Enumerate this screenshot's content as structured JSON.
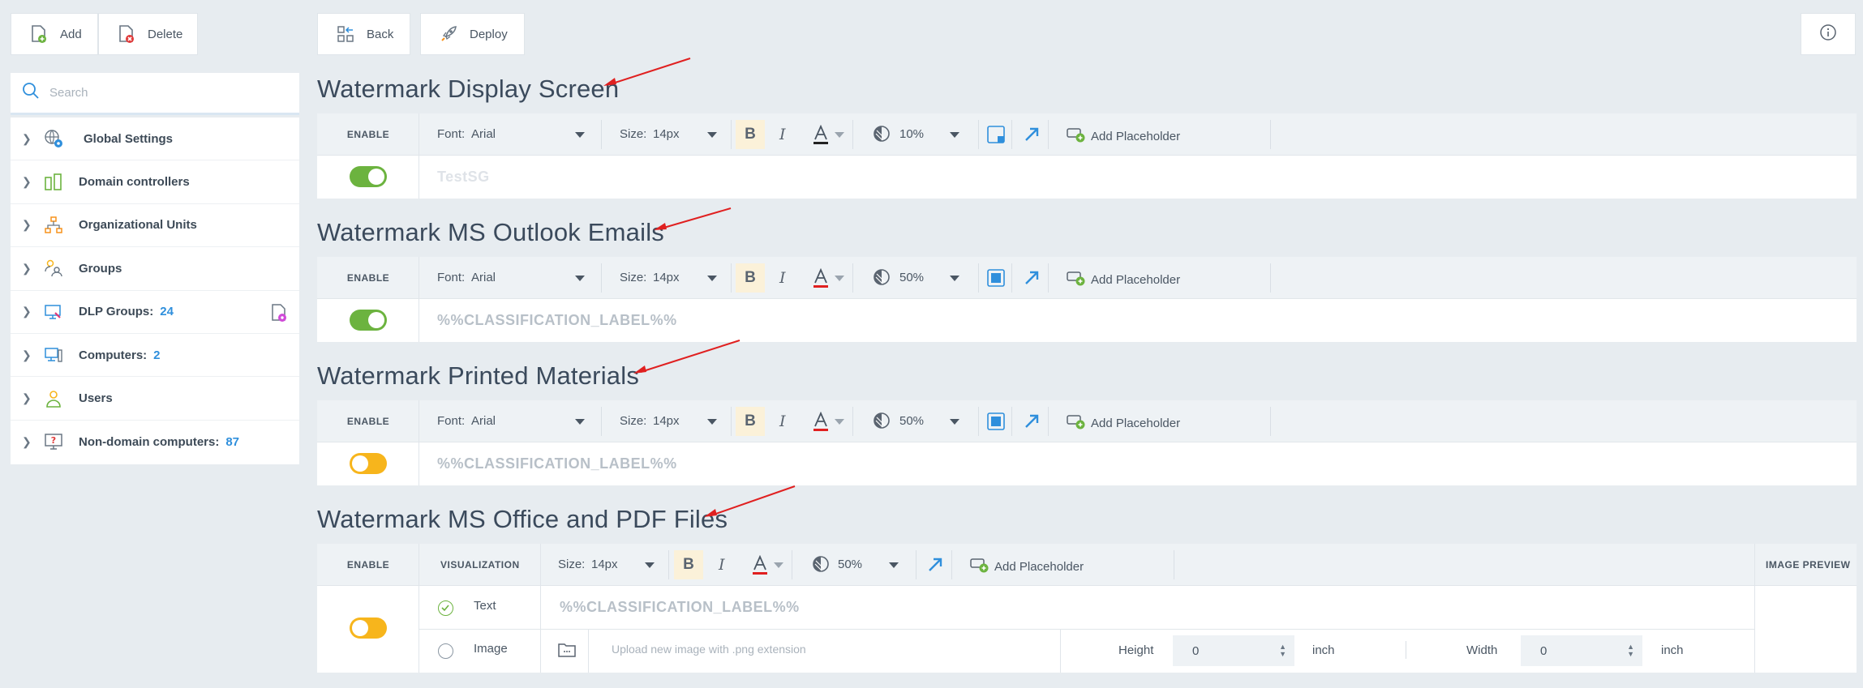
{
  "left_toolbar": {
    "add_label": "Add",
    "delete_label": "Delete"
  },
  "main_toolbar": {
    "back_label": "Back",
    "deploy_label": "Deploy"
  },
  "search": {
    "placeholder": "Search"
  },
  "tree": [
    {
      "label": "Global Settings",
      "count": ""
    },
    {
      "label": "Domain controllers",
      "count": ""
    },
    {
      "label": "Organizational Units",
      "count": ""
    },
    {
      "label": "Groups",
      "count": ""
    },
    {
      "label": "DLP Groups:",
      "count": "24"
    },
    {
      "label": "Computers:",
      "count": "2"
    },
    {
      "label": "Users",
      "count": ""
    },
    {
      "label": "Non-domain computers:",
      "count": "87"
    }
  ],
  "sections": [
    {
      "title": "Watermark Display Screen",
      "enable_label": "ENABLE",
      "font_label": "Font:",
      "font_value": "Arial",
      "size_label": "Size:",
      "size_value": "14px",
      "opacity": "10%",
      "placeholder_label": "Add Placeholder",
      "watermark_text": "TestSG",
      "enabled": true
    },
    {
      "title": "Watermark MS Outlook Emails",
      "enable_label": "ENABLE",
      "font_label": "Font:",
      "font_value": "Arial",
      "size_label": "Size:",
      "size_value": "14px",
      "opacity": "50%",
      "placeholder_label": "Add Placeholder",
      "watermark_text": "%%CLASSIFICATION_LABEL%%",
      "enabled": true
    },
    {
      "title": "Watermark Printed Materials",
      "enable_label": "ENABLE",
      "font_label": "Font:",
      "font_value": "Arial",
      "size_label": "Size:",
      "size_value": "14px",
      "opacity": "50%",
      "placeholder_label": "Add Placeholder",
      "watermark_text": "%%CLASSIFICATION_LABEL%%",
      "enabled": false
    }
  ],
  "office": {
    "title": "Watermark MS Office and PDF Files",
    "enable_label": "ENABLE",
    "visualization_label": "VISUALIZATION",
    "size_label": "Size:",
    "size_value": "14px",
    "opacity": "50%",
    "placeholder_label": "Add Placeholder",
    "image_preview_label": "IMAGE PREVIEW",
    "text_option": "Text",
    "image_option": "Image",
    "watermark_text": "%%CLASSIFICATION_LABEL%%",
    "upload_placeholder": "Upload new image with .png extension",
    "height_label": "Height",
    "height_value": "0",
    "width_label": "Width",
    "width_value": "0",
    "unit": "inch",
    "enabled": false
  },
  "colors": {
    "accent": "#2f8fdc",
    "toggle_on": "#6cb33f",
    "toggle_off": "#f7b51c",
    "arrow": "#e02020"
  }
}
